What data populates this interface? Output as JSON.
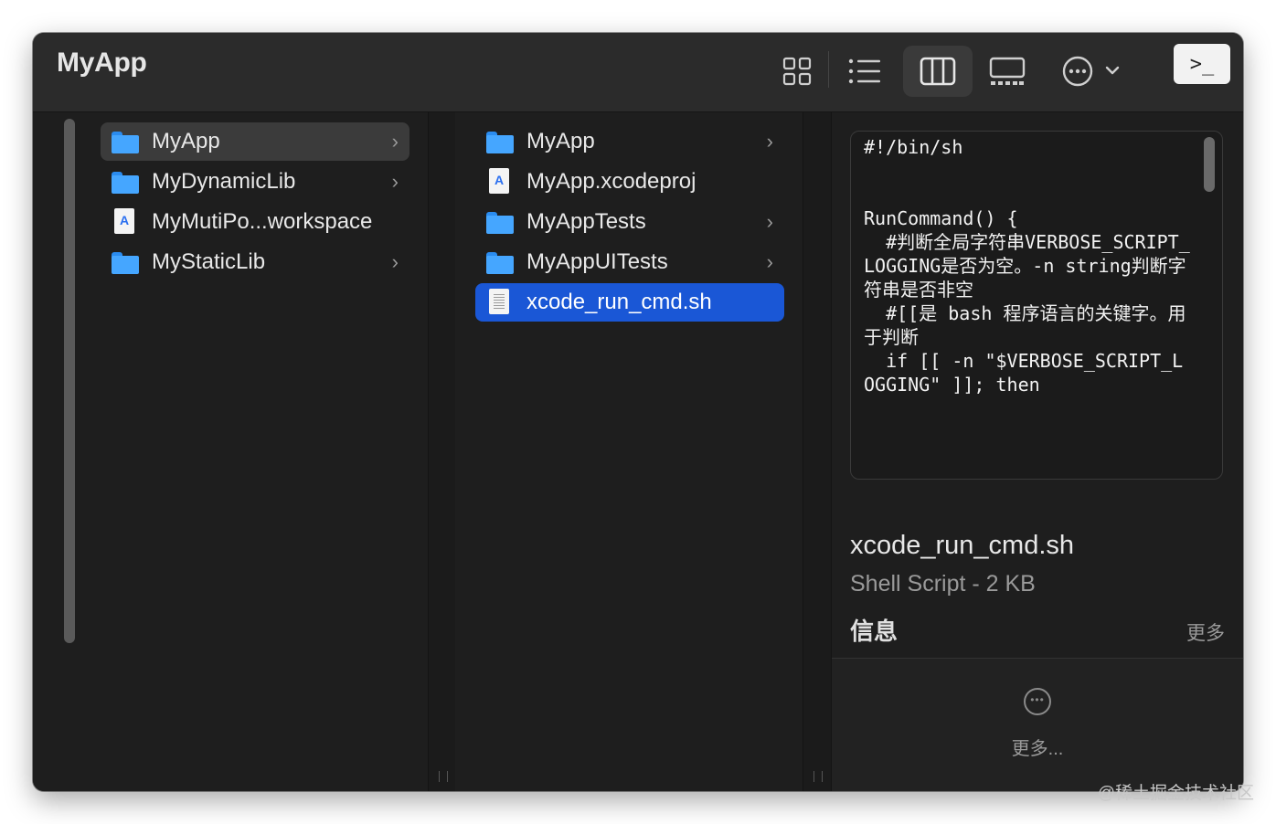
{
  "window": {
    "title": "MyApp"
  },
  "toolbar": {
    "icons": [
      "grid-view-icon",
      "list-view-icon",
      "column-view-icon",
      "gallery-view-icon",
      "more-actions-icon",
      "chevron-down-icon",
      "terminal-icon"
    ],
    "terminal_label": ">_"
  },
  "column1": {
    "items": [
      {
        "name": "MyApp",
        "icon": "folder-icon",
        "has_children": true,
        "selected": "inactive"
      },
      {
        "name": "MyDynamicLib",
        "icon": "folder-icon",
        "has_children": true
      },
      {
        "name": "MyMutiPo...workspace",
        "icon": "workspace-icon",
        "has_children": false
      },
      {
        "name": "MyStaticLib",
        "icon": "folder-icon",
        "has_children": true
      }
    ]
  },
  "column2": {
    "items": [
      {
        "name": "MyApp",
        "icon": "folder-icon",
        "has_children": true
      },
      {
        "name": "MyApp.xcodeproj",
        "icon": "xcodeproj-icon",
        "has_children": false
      },
      {
        "name": "MyAppTests",
        "icon": "folder-icon",
        "has_children": true
      },
      {
        "name": "MyAppUITests",
        "icon": "folder-icon",
        "has_children": true
      },
      {
        "name": "xcode_run_cmd.sh",
        "icon": "shell-script-icon",
        "has_children": false,
        "selected": "active"
      }
    ]
  },
  "preview": {
    "code": "#!/bin/sh\n\n\nRunCommand() {\n  #判断全局字符串VERBOSE_SCRIPT_LOGGING是否为空。-n string判断字符串是否非空\n  #[[是 bash 程序语言的关键字。用于判断\n  if [[ -n \"$VERBOSE_SCRIPT_LOGGING\" ]]; then",
    "file_name": "xcode_run_cmd.sh",
    "file_kind": "Shell Script - 2 KB",
    "info_heading": "信息",
    "info_more": "更多",
    "more_button": "更多..."
  },
  "watermark": "@稀土掘金技术社区",
  "colors": {
    "selection_blue": "#1a57d6",
    "folder_blue": "#45a6ff",
    "window_bg": "#1e1e1e"
  }
}
